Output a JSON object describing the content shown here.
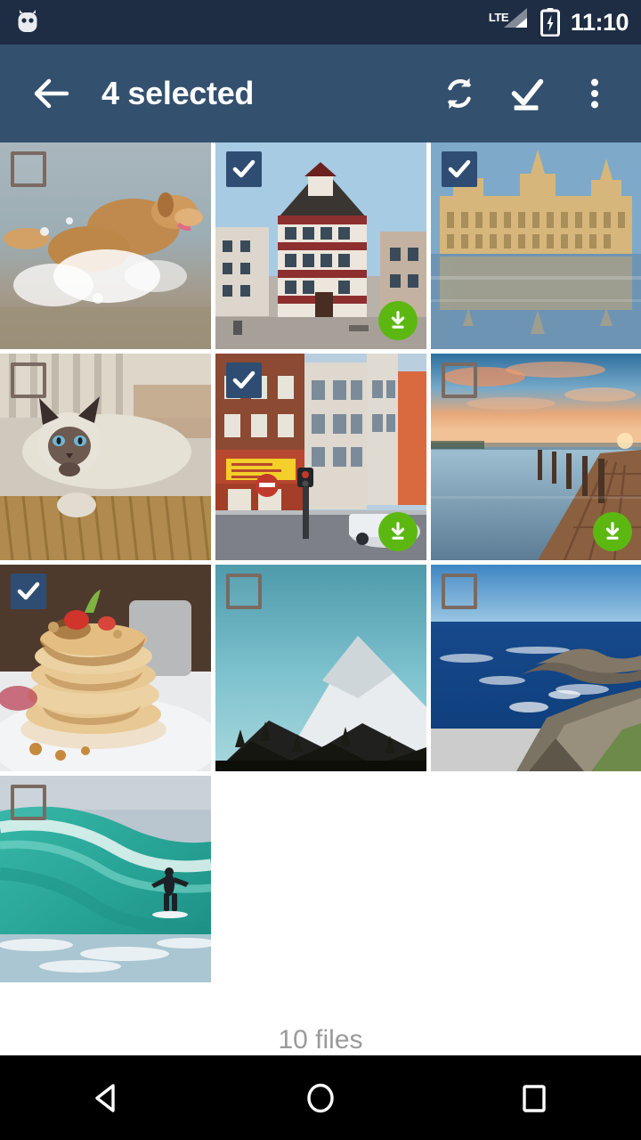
{
  "status_bar": {
    "app_icon": "android-robot-icon",
    "network_label": "LTE",
    "signal_icon": "signal-triangle-icon",
    "battery_icon": "battery-charging-icon",
    "time": "11:10",
    "background_color": "#1e2d44"
  },
  "toolbar": {
    "back_icon": "arrow-back-icon",
    "title": "4 selected",
    "background_color": "#34506f",
    "actions": [
      {
        "name": "sync-icon",
        "label": "Sync"
      },
      {
        "name": "select-all-icon",
        "label": "Select all"
      },
      {
        "name": "overflow-menu-icon",
        "label": "More options"
      }
    ]
  },
  "grid": {
    "columns": 3,
    "checked_color": "#2f4d73",
    "unchecked_border_color": "#7a6a62",
    "download_badge_color": "#5cb811",
    "items": [
      {
        "name": "thumbnail-dog-running-in-water",
        "checked": false,
        "downloaded": false
      },
      {
        "name": "thumbnail-half-timbered-house",
        "checked": true,
        "downloaded": true
      },
      {
        "name": "thumbnail-palace-reflection",
        "checked": true,
        "downloaded": false
      },
      {
        "name": "thumbnail-siamese-cat",
        "checked": false,
        "downloaded": false
      },
      {
        "name": "thumbnail-city-street-corner",
        "checked": true,
        "downloaded": true
      },
      {
        "name": "thumbnail-pier-at-sunset",
        "checked": false,
        "downloaded": true
      },
      {
        "name": "thumbnail-pancake-stack",
        "checked": true,
        "downloaded": false
      },
      {
        "name": "thumbnail-snowy-mountain",
        "checked": false,
        "downloaded": false
      },
      {
        "name": "thumbnail-rocky-coastline",
        "checked": false,
        "downloaded": false
      },
      {
        "name": "thumbnail-surfer-on-wave",
        "checked": false,
        "downloaded": false
      }
    ]
  },
  "footer": {
    "file_count_label": "10 files"
  },
  "nav_bar": {
    "background_color": "#000000",
    "buttons": [
      {
        "name": "nav-back-icon",
        "label": "Back"
      },
      {
        "name": "nav-home-icon",
        "label": "Home"
      },
      {
        "name": "nav-recents-icon",
        "label": "Recents"
      }
    ]
  }
}
